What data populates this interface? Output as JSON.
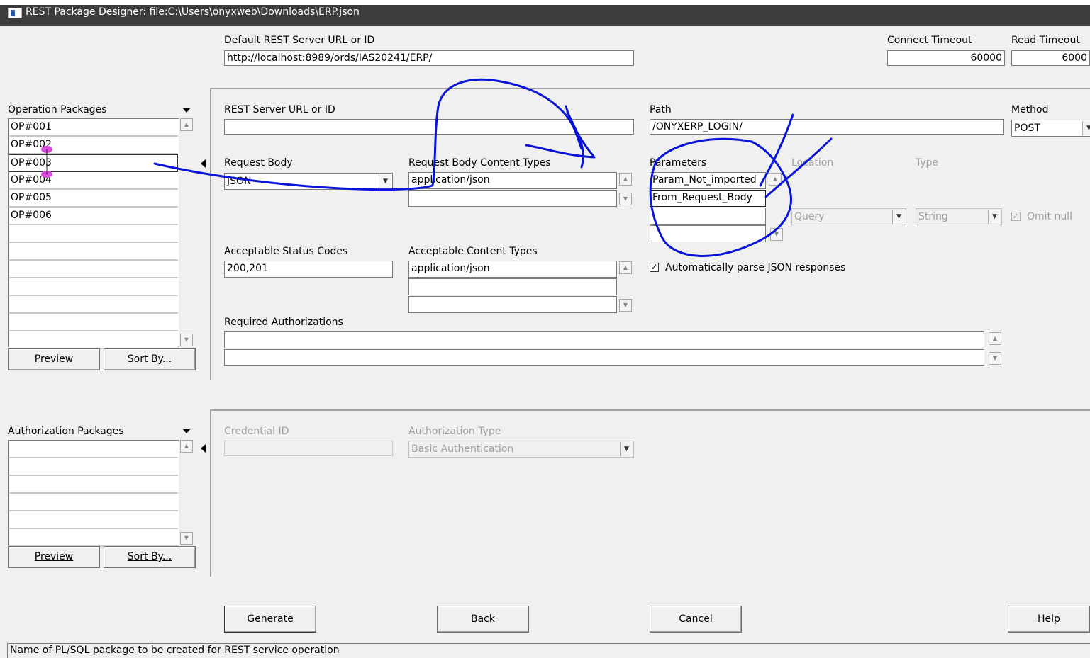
{
  "window": {
    "title": "REST Package Designer: file:C:\\Users\\onyxweb\\Downloads\\ERP.json"
  },
  "defaults": {
    "server_label": "Default REST Server URL or ID",
    "server_value": "http://localhost:8989/ords/IAS20241/ERP/",
    "connect_timeout_label": "Connect Timeout",
    "connect_timeout_value": "60000",
    "read_timeout_label": "Read Timeout",
    "read_timeout_value": "6000"
  },
  "operation_packages": {
    "label": "Operation Packages",
    "items": [
      "OP#001",
      "OP#002",
      "OP#003",
      "OP#004",
      "OP#005",
      "OP#006",
      "",
      "",
      "",
      "",
      "",
      "",
      ""
    ],
    "preview_label": "Preview",
    "sort_label": "Sort By..."
  },
  "operation": {
    "server_label": "REST Server URL or ID",
    "server_value": "",
    "path_label": "Path",
    "path_value": "/ONYXERP_LOGIN/",
    "method_label": "Method",
    "method_value": "POST",
    "request_body_label": "Request Body",
    "request_body_value": "JSON",
    "req_content_types_label": "Request Body Content Types",
    "req_content_types": [
      "application/json",
      ""
    ],
    "parameters_label": "Parameters",
    "parameters": [
      "Param_Not_imported",
      "From_Request_Body",
      "",
      ""
    ],
    "location_label": "Location",
    "location_value": "Query",
    "type_label": "Type",
    "type_value": "String",
    "omit_null_label": "Omit null",
    "status_codes_label": "Acceptable Status Codes",
    "status_codes_value": "200,201",
    "acc_content_types_label": "Acceptable Content Types",
    "acc_content_types": [
      "application/json",
      "",
      ""
    ],
    "auto_parse_label": "Automatically parse JSON responses",
    "auto_parse_checked": true,
    "required_auth_label": "Required Authorizations",
    "required_auth": [
      "",
      ""
    ]
  },
  "authorization_packages": {
    "label": "Authorization Packages",
    "items": [
      "",
      "",
      "",
      "",
      "",
      ""
    ],
    "preview_label": "Preview",
    "sort_label": "Sort By..."
  },
  "authorization": {
    "credential_label": "Credential ID",
    "credential_value": "",
    "type_label": "Authorization Type",
    "type_value": "Basic Authentication"
  },
  "buttons": {
    "generate": "Generate",
    "back": "Back",
    "cancel": "Cancel",
    "help": "Help"
  },
  "status": "Name of PL/SQL package to be created for REST service operation",
  "colors": {
    "titlebar": "#3c3c3c",
    "annotation_ink": "#0a14d8",
    "pin_marker": "#d94ce0"
  }
}
